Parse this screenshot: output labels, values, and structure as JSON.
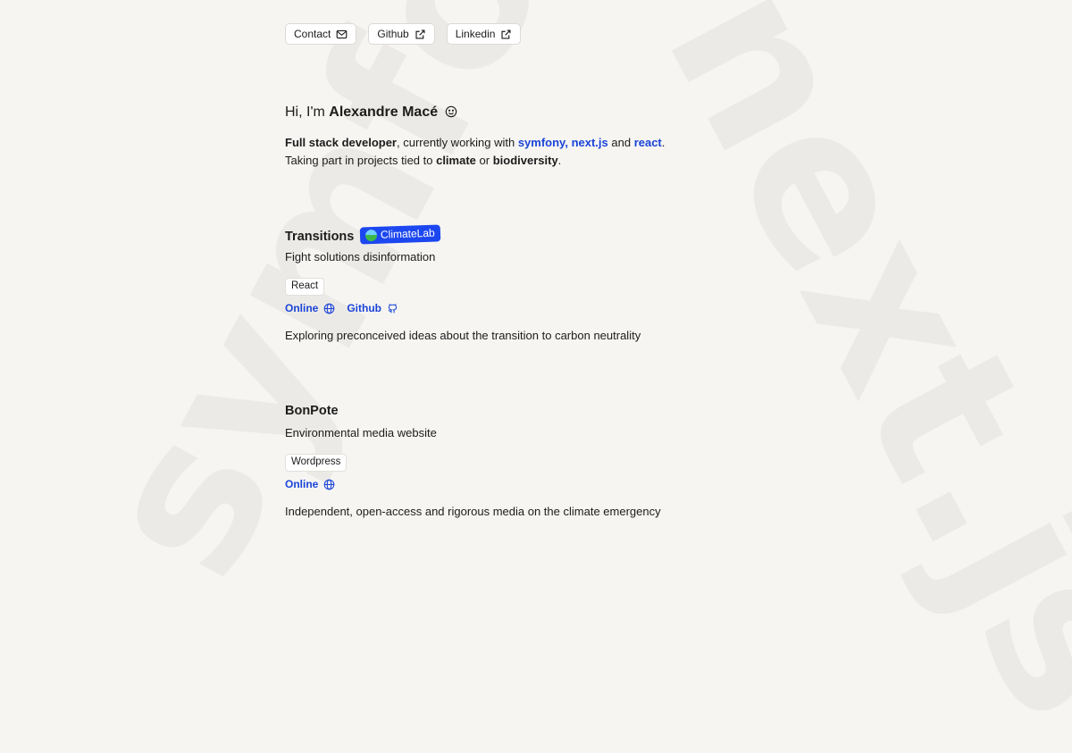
{
  "background": {
    "word_left": "symfony",
    "word_right": "next.js",
    "color": "#eceae6"
  },
  "nav": {
    "contact_label": "Contact",
    "github_label": "Github",
    "linkedin_label": "Linkedin"
  },
  "hero": {
    "greeting_prefix": "Hi, I'm ",
    "name": "Alexandre Macé",
    "intro_role": "Full stack developer",
    "intro_mid": ", currently working with ",
    "tech_symfony": "symfony",
    "tech_sep": ",",
    "tech_next": "next.js",
    "intro_and": " and ",
    "tech_react": "react",
    "intro_end": ".",
    "line2_prefix": "Taking part in projects tied to ",
    "line2_climate": "climate",
    "line2_or": " or ",
    "line2_bio": "biodiversity",
    "line2_end": "."
  },
  "projects": [
    {
      "title": "Transitions",
      "badge": "ClimateLab",
      "subtitle": "Fight solutions disinformation",
      "tag": "React",
      "link_online": "Online",
      "link_github": "Github",
      "description": "Exploring preconceived ideas about the transition to carbon neutrality"
    },
    {
      "title": "BonPote",
      "subtitle": "Environmental media website",
      "tag": "Wordpress",
      "link_online": "Online",
      "description": "Independent, open-access and rigorous media on the climate emergency"
    }
  ],
  "colors": {
    "accent": "#1a44d8",
    "badge": "#1c47f0",
    "background": "#f6f5f2"
  }
}
